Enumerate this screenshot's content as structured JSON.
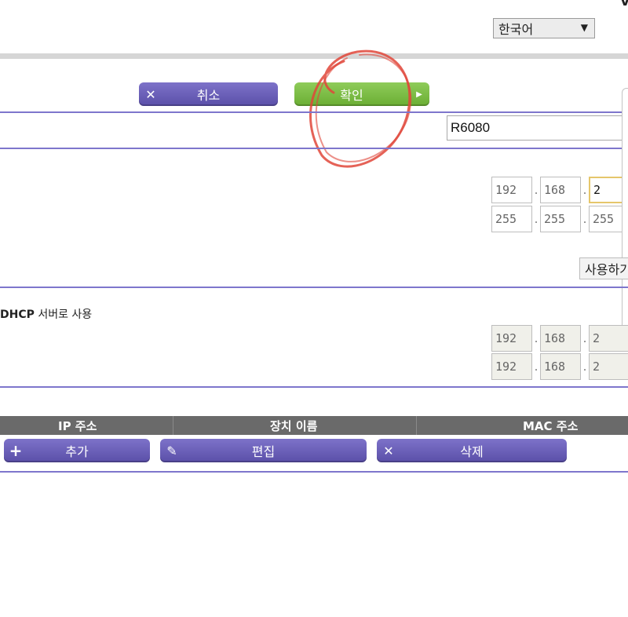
{
  "header": {
    "corner_letter": "V",
    "language": {
      "selected": "한국어",
      "caret": "▼"
    }
  },
  "actions": {
    "cancel_label": "취소",
    "ok_label": "확인"
  },
  "device_name": {
    "value": "R6080"
  },
  "lan_ip": {
    "ip": [
      "192",
      "168",
      "2"
    ],
    "subnet": [
      "255",
      "255",
      "255"
    ]
  },
  "apply_button_label": "사용하기",
  "dhcp": {
    "label_bold": "DHCP",
    "label_rest": " 서버로 사용",
    "start": [
      "192",
      "168",
      "2"
    ],
    "end": [
      "192",
      "168",
      "2"
    ]
  },
  "reserved_table": {
    "columns": [
      "IP 주소",
      "장치 이름",
      "MAC 주소"
    ],
    "add_label": "추가",
    "edit_label": "편집",
    "delete_label": "삭제"
  },
  "colors": {
    "button_purple": "#6b60b8",
    "button_green": "#7bbd44",
    "rule": "#7e76cc",
    "annotation_circle": "#e0463a"
  }
}
